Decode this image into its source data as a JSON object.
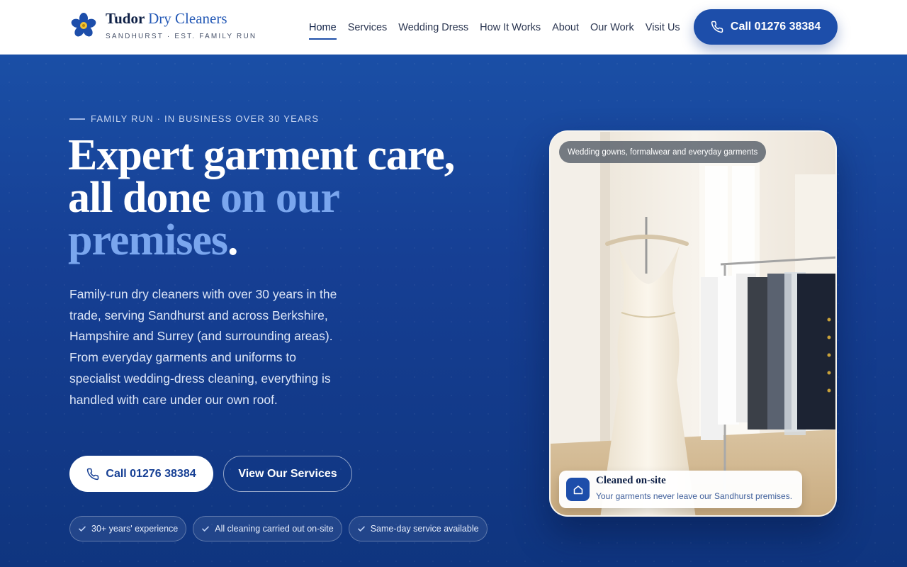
{
  "header": {
    "brand_primary": "Tudor",
    "brand_accent": "Dry Cleaners",
    "tagline": "SANDHURST · EST. FAMILY RUN",
    "logo_icon": "flower-icon",
    "nav": [
      {
        "label": "Home",
        "active": true
      },
      {
        "label": "Services"
      },
      {
        "label": "Wedding Dress"
      },
      {
        "label": "How It Works"
      },
      {
        "label": "About"
      },
      {
        "label": "Our Work"
      },
      {
        "label": "Visit Us"
      }
    ],
    "call_label": "Call 01276 38384",
    "call_icon": "phone-icon"
  },
  "hero": {
    "eyebrow": "FAMILY RUN · IN BUSINESS OVER 30 YEARS",
    "headline_part1": "Expert garment care, all done ",
    "headline_highlight": "on our premises",
    "headline_end": ".",
    "intro": "Family-run dry cleaners with over 30 years in the trade, serving Sandhurst and across Berkshire, Hampshire and Surrey (and surrounding areas). From everyday garments and uniforms to specialist wedding-dress cleaning, everything is handled with care under our own roof.",
    "call_button": "Call 01276 38384",
    "services_button": "View Our Services",
    "badges": [
      "30+ years' experience",
      "All cleaning carried out on-site",
      "Same-day service available"
    ]
  },
  "photo": {
    "tag": "Wedding gowns, formalwear and everyday garments",
    "onsite_title": "Cleaned on-site",
    "onsite_sub": "Your garments never leave our Sandhurst premises.",
    "onsite_icon": "home-icon"
  },
  "colors": {
    "brand_blue": "#1d4eaa",
    "hero_top": "#1a4fa6",
    "hero_bottom": "#0f357f",
    "highlight": "#7aa6ee",
    "ink": "#0d1f45"
  }
}
